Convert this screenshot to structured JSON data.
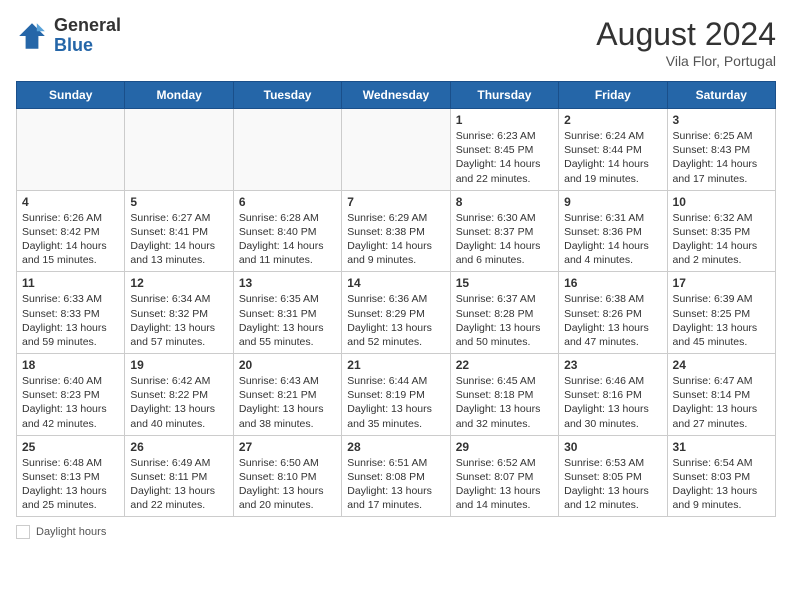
{
  "header": {
    "logo_general": "General",
    "logo_blue": "Blue",
    "month_year": "August 2024",
    "location": "Vila Flor, Portugal"
  },
  "weekdays": [
    "Sunday",
    "Monday",
    "Tuesday",
    "Wednesday",
    "Thursday",
    "Friday",
    "Saturday"
  ],
  "weeks": [
    [
      {
        "day": "",
        "info": ""
      },
      {
        "day": "",
        "info": ""
      },
      {
        "day": "",
        "info": ""
      },
      {
        "day": "",
        "info": ""
      },
      {
        "day": "1",
        "info": "Sunrise: 6:23 AM\nSunset: 8:45 PM\nDaylight: 14 hours and 22 minutes."
      },
      {
        "day": "2",
        "info": "Sunrise: 6:24 AM\nSunset: 8:44 PM\nDaylight: 14 hours and 19 minutes."
      },
      {
        "day": "3",
        "info": "Sunrise: 6:25 AM\nSunset: 8:43 PM\nDaylight: 14 hours and 17 minutes."
      }
    ],
    [
      {
        "day": "4",
        "info": "Sunrise: 6:26 AM\nSunset: 8:42 PM\nDaylight: 14 hours and 15 minutes."
      },
      {
        "day": "5",
        "info": "Sunrise: 6:27 AM\nSunset: 8:41 PM\nDaylight: 14 hours and 13 minutes."
      },
      {
        "day": "6",
        "info": "Sunrise: 6:28 AM\nSunset: 8:40 PM\nDaylight: 14 hours and 11 minutes."
      },
      {
        "day": "7",
        "info": "Sunrise: 6:29 AM\nSunset: 8:38 PM\nDaylight: 14 hours and 9 minutes."
      },
      {
        "day": "8",
        "info": "Sunrise: 6:30 AM\nSunset: 8:37 PM\nDaylight: 14 hours and 6 minutes."
      },
      {
        "day": "9",
        "info": "Sunrise: 6:31 AM\nSunset: 8:36 PM\nDaylight: 14 hours and 4 minutes."
      },
      {
        "day": "10",
        "info": "Sunrise: 6:32 AM\nSunset: 8:35 PM\nDaylight: 14 hours and 2 minutes."
      }
    ],
    [
      {
        "day": "11",
        "info": "Sunrise: 6:33 AM\nSunset: 8:33 PM\nDaylight: 13 hours and 59 minutes."
      },
      {
        "day": "12",
        "info": "Sunrise: 6:34 AM\nSunset: 8:32 PM\nDaylight: 13 hours and 57 minutes."
      },
      {
        "day": "13",
        "info": "Sunrise: 6:35 AM\nSunset: 8:31 PM\nDaylight: 13 hours and 55 minutes."
      },
      {
        "day": "14",
        "info": "Sunrise: 6:36 AM\nSunset: 8:29 PM\nDaylight: 13 hours and 52 minutes."
      },
      {
        "day": "15",
        "info": "Sunrise: 6:37 AM\nSunset: 8:28 PM\nDaylight: 13 hours and 50 minutes."
      },
      {
        "day": "16",
        "info": "Sunrise: 6:38 AM\nSunset: 8:26 PM\nDaylight: 13 hours and 47 minutes."
      },
      {
        "day": "17",
        "info": "Sunrise: 6:39 AM\nSunset: 8:25 PM\nDaylight: 13 hours and 45 minutes."
      }
    ],
    [
      {
        "day": "18",
        "info": "Sunrise: 6:40 AM\nSunset: 8:23 PM\nDaylight: 13 hours and 42 minutes."
      },
      {
        "day": "19",
        "info": "Sunrise: 6:42 AM\nSunset: 8:22 PM\nDaylight: 13 hours and 40 minutes."
      },
      {
        "day": "20",
        "info": "Sunrise: 6:43 AM\nSunset: 8:21 PM\nDaylight: 13 hours and 38 minutes."
      },
      {
        "day": "21",
        "info": "Sunrise: 6:44 AM\nSunset: 8:19 PM\nDaylight: 13 hours and 35 minutes."
      },
      {
        "day": "22",
        "info": "Sunrise: 6:45 AM\nSunset: 8:18 PM\nDaylight: 13 hours and 32 minutes."
      },
      {
        "day": "23",
        "info": "Sunrise: 6:46 AM\nSunset: 8:16 PM\nDaylight: 13 hours and 30 minutes."
      },
      {
        "day": "24",
        "info": "Sunrise: 6:47 AM\nSunset: 8:14 PM\nDaylight: 13 hours and 27 minutes."
      }
    ],
    [
      {
        "day": "25",
        "info": "Sunrise: 6:48 AM\nSunset: 8:13 PM\nDaylight: 13 hours and 25 minutes."
      },
      {
        "day": "26",
        "info": "Sunrise: 6:49 AM\nSunset: 8:11 PM\nDaylight: 13 hours and 22 minutes."
      },
      {
        "day": "27",
        "info": "Sunrise: 6:50 AM\nSunset: 8:10 PM\nDaylight: 13 hours and 20 minutes."
      },
      {
        "day": "28",
        "info": "Sunrise: 6:51 AM\nSunset: 8:08 PM\nDaylight: 13 hours and 17 minutes."
      },
      {
        "day": "29",
        "info": "Sunrise: 6:52 AM\nSunset: 8:07 PM\nDaylight: 13 hours and 14 minutes."
      },
      {
        "day": "30",
        "info": "Sunrise: 6:53 AM\nSunset: 8:05 PM\nDaylight: 13 hours and 12 minutes."
      },
      {
        "day": "31",
        "info": "Sunrise: 6:54 AM\nSunset: 8:03 PM\nDaylight: 13 hours and 9 minutes."
      }
    ]
  ],
  "footer": {
    "label": "Daylight hours"
  }
}
